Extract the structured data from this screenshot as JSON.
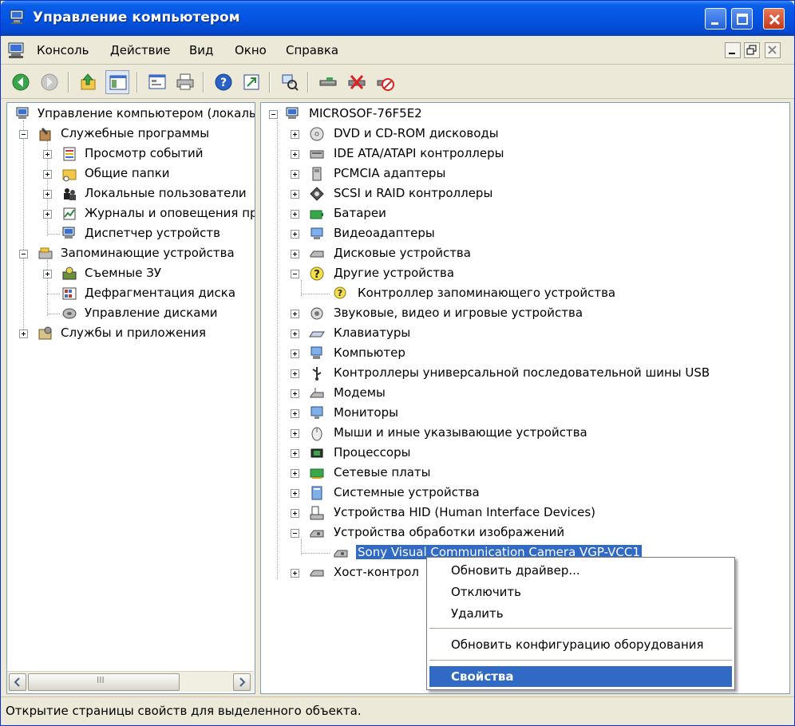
{
  "window": {
    "title": "Управление компьютером"
  },
  "menu": [
    "Консоль",
    "Действие",
    "Вид",
    "Окно",
    "Справка"
  ],
  "toolbar_icons": [
    "back-icon",
    "forward-icon",
    "up-folder-icon",
    "show-tree-icon",
    "properties-icon",
    "print-icon",
    "help-icon",
    "export-icon",
    "scan-hardware-icon",
    "update-driver-icon",
    "disable-device-icon",
    "uninstall-device-icon"
  ],
  "left_tree": [
    {
      "label": "Управление компьютером (локаль",
      "icon": "computer-icon"
    },
    {
      "label": "Служебные программы",
      "icon": "tools-icon"
    },
    {
      "label": "Просмотр событий",
      "icon": "event-viewer-icon"
    },
    {
      "label": "Общие папки",
      "icon": "shared-folder-icon"
    },
    {
      "label": "Локальные пользователи",
      "icon": "users-icon"
    },
    {
      "label": "Журналы и оповещения пр",
      "icon": "performance-logs-icon"
    },
    {
      "label": "Диспетчер устройств",
      "icon": "device-manager-icon"
    },
    {
      "label": "Запоминающие устройства",
      "icon": "storage-icon"
    },
    {
      "label": "Съемные ЗУ",
      "icon": "removable-storage-icon"
    },
    {
      "label": "Дефрагментация диска",
      "icon": "defrag-icon"
    },
    {
      "label": "Управление дисками",
      "icon": "disk-management-icon"
    },
    {
      "label": "Службы и приложения",
      "icon": "services-icon"
    }
  ],
  "device_tree": {
    "root": "MICROSOF-76F5E2",
    "categories": [
      "DVD и CD-ROM дисководы",
      "IDE ATA/ATAPI контроллеры",
      "PCMCIA адаптеры",
      "SCSI и RAID контроллеры",
      "Батареи",
      "Видеоадаптеры",
      "Дисковые устройства",
      "Другие устройства",
      "Контроллер запоминающего устройства",
      "Звуковые, видео и игровые устройства",
      "Клавиатуры",
      "Компьютер",
      "Контроллеры универсальной последовательной шины USB",
      "Модемы",
      "Мониторы",
      "Мыши и иные указывающие устройства",
      "Процессоры",
      "Сетевые платы",
      "Системные устройства",
      "Устройства HID (Human Interface Devices)",
      "Устройства обработки изображений",
      "Sony Visual Communication Camera VGP-VCC1",
      "Хост-контрол"
    ]
  },
  "context_menu": {
    "update_driver": "Обновить драйвер...",
    "disable": "Отключить",
    "delete": "Удалить",
    "scan": "Обновить конфигурацию оборудования",
    "properties": "Свойства"
  },
  "scrollbar": {
    "thumb_grip": "III"
  },
  "status": "Открытие страницы свойств для выделенного объекта.",
  "colors": {
    "title_blue": "#0554e3",
    "selection": "#316ac5",
    "chrome": "#ece9d8"
  }
}
